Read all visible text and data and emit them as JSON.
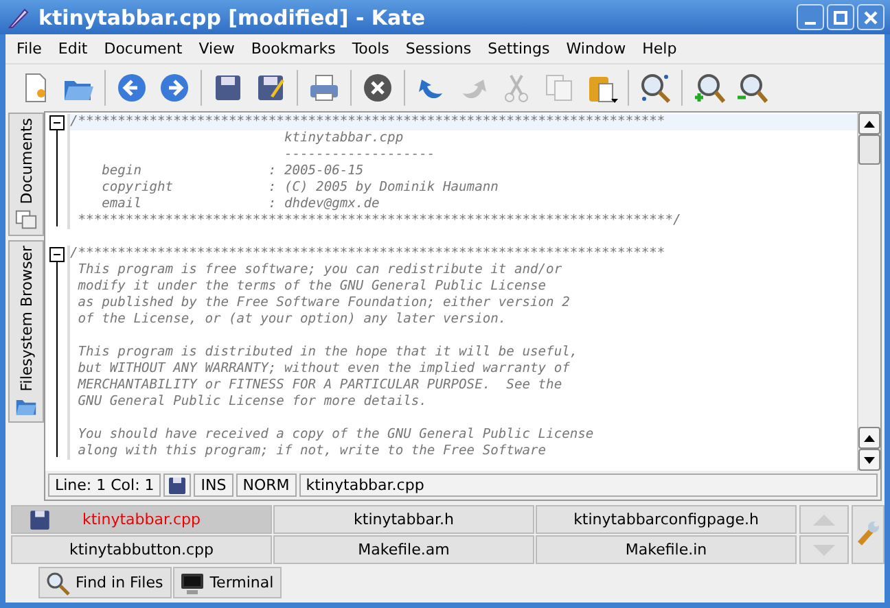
{
  "window": {
    "title": "ktinytabbar.cpp [modified] - Kate"
  },
  "menu": [
    "File",
    "Edit",
    "Document",
    "View",
    "Bookmarks",
    "Tools",
    "Sessions",
    "Settings",
    "Window",
    "Help"
  ],
  "toolbar": [
    {
      "kind": "new",
      "disabled": false
    },
    {
      "kind": "open",
      "disabled": false
    },
    {
      "kind": "separator"
    },
    {
      "kind": "back",
      "disabled": false
    },
    {
      "kind": "forward",
      "disabled": false
    },
    {
      "kind": "separator"
    },
    {
      "kind": "save",
      "disabled": false
    },
    {
      "kind": "save-as",
      "disabled": false
    },
    {
      "kind": "separator"
    },
    {
      "kind": "print",
      "disabled": false
    },
    {
      "kind": "separator"
    },
    {
      "kind": "close",
      "disabled": false
    },
    {
      "kind": "separator"
    },
    {
      "kind": "undo",
      "disabled": false
    },
    {
      "kind": "redo",
      "disabled": true
    },
    {
      "kind": "cut",
      "disabled": true
    },
    {
      "kind": "copy",
      "disabled": true
    },
    {
      "kind": "paste",
      "disabled": false
    },
    {
      "kind": "separator"
    },
    {
      "kind": "find",
      "disabled": false
    },
    {
      "kind": "separator"
    },
    {
      "kind": "zoom-in",
      "disabled": false
    },
    {
      "kind": "zoom-out",
      "disabled": false
    }
  ],
  "sidebar": {
    "tabs": [
      {
        "label": "Documents",
        "kind": "documents"
      },
      {
        "label": "Filesystem Browser",
        "kind": "filesystem"
      }
    ]
  },
  "editor": {
    "blocks": [
      {
        "expanded": true,
        "paragraphs": [
          [
            "/**************************************************************************",
            "                           ktinytabbar.cpp",
            "                           -------------------",
            "    begin                : 2005-06-15",
            "    copyright            : (C) 2005 by Dominik Haumann",
            "    email                : dhdev@gmx.de",
            " ***************************************************************************/"
          ]
        ]
      },
      {
        "expanded": true,
        "paragraphs": [
          [
            "/**************************************************************************",
            " This program is free software; you can redistribute it and/or",
            " modify it under the terms of the GNU General Public License",
            " as published by the Free Software Foundation; either version 2",
            " of the License, or (at your option) any later version."
          ],
          [
            " This program is distributed in the hope that it will be useful,",
            " but WITHOUT ANY WARRANTY; without even the implied warranty of",
            " MERCHANTABILITY or FITNESS FOR A PARTICULAR PURPOSE.  See the",
            " GNU General Public License for more details."
          ],
          [
            " You should have received a copy of the GNU General Public License",
            " along with this program; if not, write to the Free Software"
          ]
        ]
      }
    ]
  },
  "status_bar": {
    "position": "Line: 1 Col: 1",
    "modified": true,
    "insert_mode": "INS",
    "input_mode": "NORM",
    "file": "ktinytabbar.cpp"
  },
  "document_tabs": [
    {
      "label": "ktinytabbar.cpp",
      "selected": true,
      "modified": true
    },
    {
      "label": "ktinytabbar.h",
      "selected": false,
      "modified": false
    },
    {
      "label": "ktinytabbarconfigpage.h",
      "selected": false,
      "modified": false
    },
    {
      "label": "ktinytabbutton.cpp",
      "selected": false,
      "modified": false
    },
    {
      "label": "Makefile.am",
      "selected": false,
      "modified": false
    },
    {
      "label": "Makefile.in",
      "selected": false,
      "modified": false
    }
  ],
  "tool_views": [
    {
      "label": "Find in Files",
      "kind": "find"
    },
    {
      "label": "Terminal",
      "kind": "terminal"
    }
  ]
}
